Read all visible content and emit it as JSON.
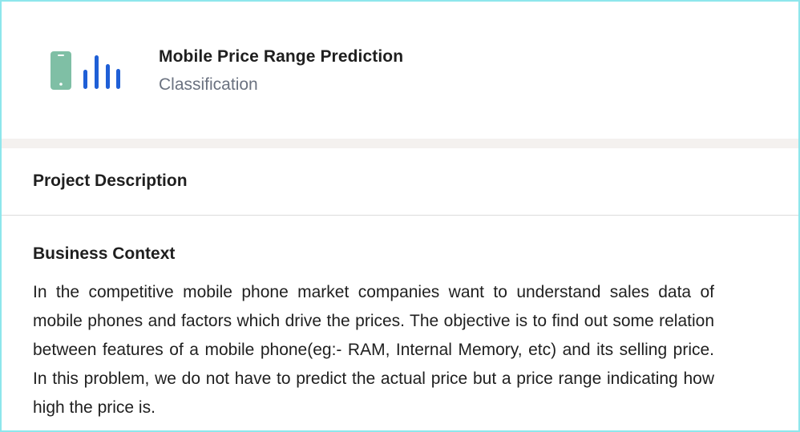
{
  "project": {
    "title": "Mobile Price Range Prediction",
    "category": "Classification",
    "logo_icon": "phone-bar-chart-icon",
    "colors": {
      "phone": "#7fbfa5",
      "bars": "#1f5fd6",
      "frame_border": "#8ee6ec",
      "band": "#f4f1ef"
    }
  },
  "description": {
    "section_title": "Project Description",
    "context_heading": "Business Context",
    "context_text": "In the competitive mobile phone market companies want to understand sales data of mobile phones and factors which drive the prices. The objective is to find out some relation between features of a mobile phone(eg:- RAM, Internal Memory, etc) and its selling price. In this problem, we do not have to predict the actual price but a price range indicating how high the price is."
  }
}
